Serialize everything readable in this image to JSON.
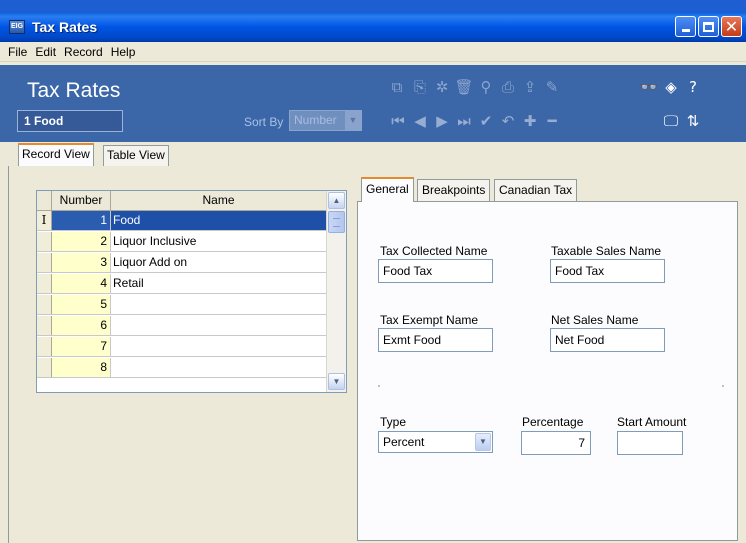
{
  "window": {
    "title": "Tax Rates",
    "app_icon_text": "EIG"
  },
  "menu": [
    "File",
    "Edit",
    "Record",
    "Help"
  ],
  "header": {
    "title": "Tax Rates",
    "current_record": "1 Food",
    "sort_by_label": "Sort By",
    "sort_by_value": "Number"
  },
  "outer_tabs": [
    "Record View",
    "Table View"
  ],
  "grid": {
    "columns": [
      "Number",
      "Name"
    ],
    "rows": [
      {
        "selector": "I",
        "number": "1",
        "name": "Food"
      },
      {
        "selector": "",
        "number": "2",
        "name": "Liquor Inclusive"
      },
      {
        "selector": "",
        "number": "3",
        "name": "Liquor Add on"
      },
      {
        "selector": "",
        "number": "4",
        "name": "Retail"
      },
      {
        "selector": "",
        "number": "5",
        "name": ""
      },
      {
        "selector": "",
        "number": "6",
        "name": ""
      },
      {
        "selector": "",
        "number": "7",
        "name": ""
      },
      {
        "selector": "",
        "number": "8",
        "name": ""
      }
    ]
  },
  "detail_tabs": [
    "General",
    "Breakpoints",
    "Canadian Tax"
  ],
  "form": {
    "tax_collected_name_label": "Tax Collected Name",
    "tax_collected_name_value": "Food Tax",
    "taxable_sales_name_label": "Taxable Sales Name",
    "taxable_sales_name_value": "Food Tax",
    "tax_exempt_name_label": "Tax Exempt Name",
    "tax_exempt_name_value": "Exmt Food",
    "net_sales_name_label": "Net Sales Name",
    "net_sales_name_value": "Net Food",
    "type_label": "Type",
    "type_value": "Percent",
    "percentage_label": "Percentage",
    "percentage_value": "7",
    "start_amount_label": "Start Amount",
    "start_amount_value": ""
  },
  "colors": {
    "titlebar": "#0055e5",
    "header_bg": "#3b67a8",
    "selection": "#1e50a8",
    "tab_accent": "#e68b2c"
  }
}
